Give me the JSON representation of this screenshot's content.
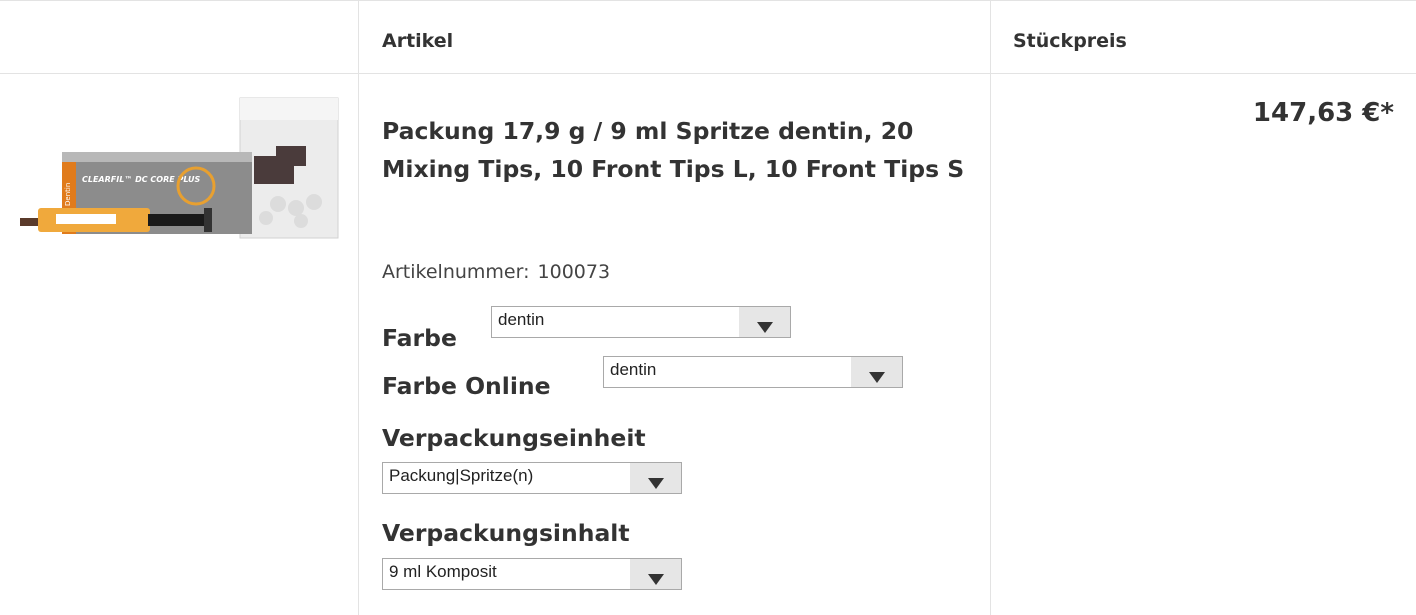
{
  "table": {
    "headers": {
      "artikel": "Artikel",
      "stueckpreis": "Stückpreis"
    }
  },
  "product": {
    "image_brand": "CLEARFIL™ DC CORE PLUS",
    "image_band": "Dentin",
    "title": "Packung 17,9 g / 9 ml Spritze dentin, 20 Mixing Tips, 10 Front Tips L, 10 Front Tips S",
    "artnr_label": "Artikelnummer:",
    "artnr_value": "100073",
    "price": "147,63 €*"
  },
  "options": {
    "farbe": {
      "label": "Farbe",
      "selected": "dentin"
    },
    "farbe_online": {
      "label": "Farbe Online",
      "selected": "dentin"
    },
    "verpackungseinheit": {
      "label": "Verpackungseinheit",
      "selected": "Packung|Spritze(n)"
    },
    "verpackungsinhalt": {
      "label": "Verpackungsinhalt",
      "selected": "9 ml Komposit"
    }
  }
}
